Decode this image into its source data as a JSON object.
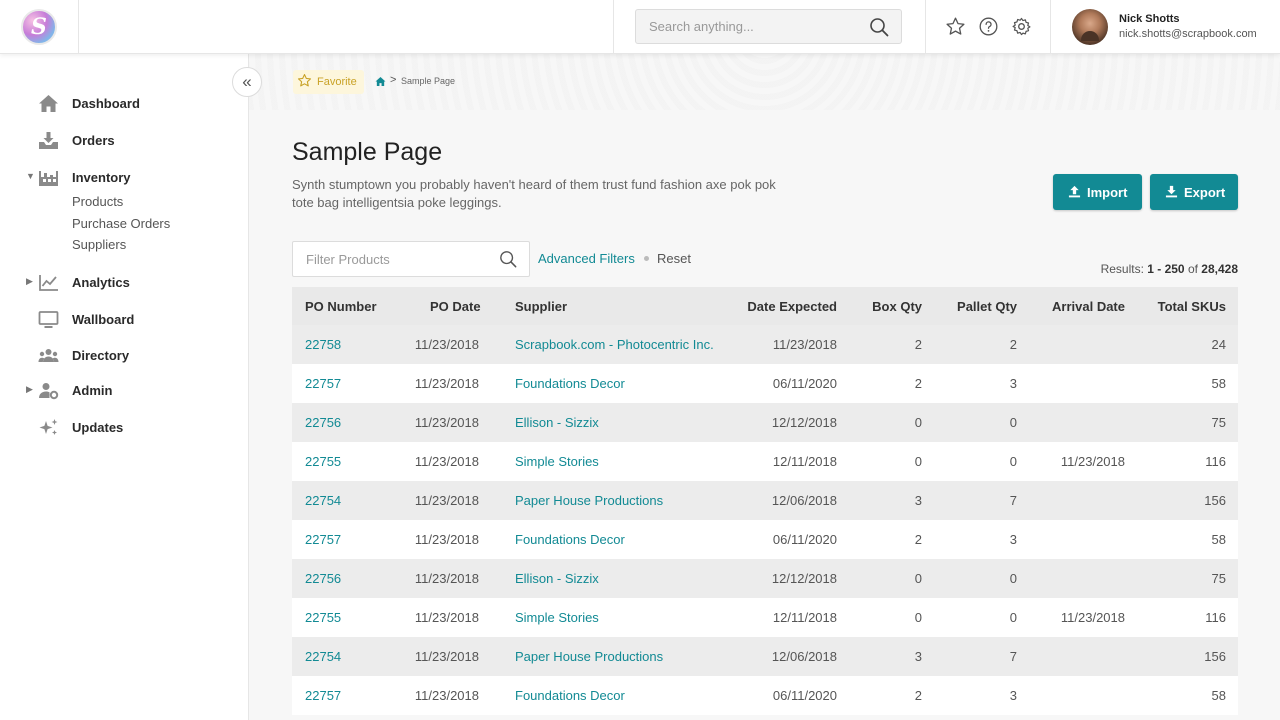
{
  "header": {
    "logo_letter": "S",
    "search_placeholder": "Search anything...",
    "user": {
      "name": "Nick Shotts",
      "email": "nick.shotts@scrapbook.com"
    }
  },
  "sidebar": {
    "items": [
      {
        "label": "Dashboard",
        "icon": "home-icon"
      },
      {
        "label": "Orders",
        "icon": "download-tray-icon"
      },
      {
        "label": "Inventory",
        "icon": "warehouse-icon",
        "expanded": true,
        "children": [
          "Products",
          "Purchase Orders",
          "Suppliers"
        ]
      },
      {
        "label": "Analytics",
        "icon": "chart-icon"
      },
      {
        "label": "Wallboard",
        "icon": "monitor-icon"
      },
      {
        "label": "Directory",
        "icon": "users-icon"
      },
      {
        "label": "Admin",
        "icon": "user-gear-icon"
      },
      {
        "label": "Updates",
        "icon": "sparkle-icon"
      }
    ],
    "collapse_glyph": "«"
  },
  "breadcrumb": {
    "favorite_label": "Favorite",
    "separator": ">",
    "page": "Sample Page"
  },
  "page": {
    "title": "Sample Page",
    "description": "Synth stumptown you probably haven't heard of them trust fund fashion axe pok pok tote bag intelligentsia poke leggings.",
    "import_label": "Import",
    "export_label": "Export"
  },
  "filters": {
    "placeholder": "Filter Products",
    "advanced_label": "Advanced Filters",
    "reset_label": "Reset"
  },
  "results": {
    "prefix": "Results: ",
    "range": "1 - 250",
    "of": " of ",
    "total": "28,428"
  },
  "table": {
    "columns": [
      "PO Number",
      "PO Date",
      "Supplier",
      "Date Expected",
      "Box Qty",
      "Pallet Qty",
      "Arrival Date",
      "Total SKUs"
    ],
    "rows": [
      [
        "22758",
        "11/23/2018",
        "Scrapbook.com - Photocentric Inc.",
        "11/23/2018",
        "2",
        "2",
        "",
        "24"
      ],
      [
        "22757",
        "11/23/2018",
        "Foundations Decor",
        "06/11/2020",
        "2",
        "3",
        "",
        "58"
      ],
      [
        "22756",
        "11/23/2018",
        "Ellison - Sizzix",
        "12/12/2018",
        "0",
        "0",
        "",
        "75"
      ],
      [
        "22755",
        "11/23/2018",
        "Simple Stories",
        "12/11/2018",
        "0",
        "0",
        "11/23/2018",
        "116"
      ],
      [
        "22754",
        "11/23/2018",
        "Paper House Productions",
        "12/06/2018",
        "3",
        "7",
        "",
        "156"
      ],
      [
        "22757",
        "11/23/2018",
        "Foundations Decor",
        "06/11/2020",
        "2",
        "3",
        "",
        "58"
      ],
      [
        "22756",
        "11/23/2018",
        "Ellison - Sizzix",
        "12/12/2018",
        "0",
        "0",
        "",
        "75"
      ],
      [
        "22755",
        "11/23/2018",
        "Simple Stories",
        "12/11/2018",
        "0",
        "0",
        "11/23/2018",
        "116"
      ],
      [
        "22754",
        "11/23/2018",
        "Paper House Productions",
        "12/06/2018",
        "3",
        "7",
        "",
        "156"
      ],
      [
        "22757",
        "11/23/2018",
        "Foundations Decor",
        "06/11/2020",
        "2",
        "3",
        "",
        "58"
      ]
    ]
  },
  "colors": {
    "accent": "#128a94",
    "favorite": "#c9a227",
    "row_stripe": "#ececec"
  }
}
